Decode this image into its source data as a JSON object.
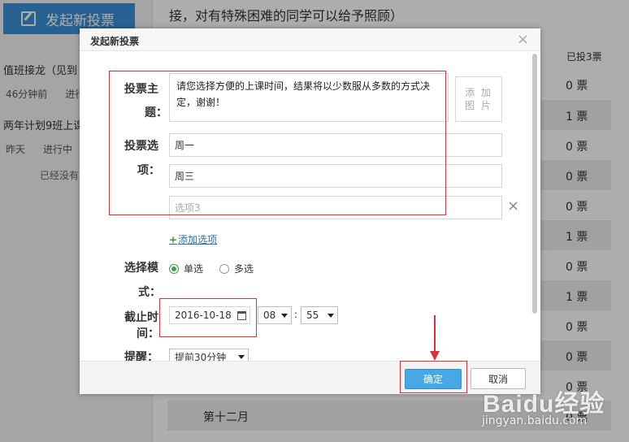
{
  "background": {
    "launch_button": "发起新投票",
    "notice_line": "接，对有特殊困难的同学可以给予照顾）",
    "entries": [
      {
        "title": "值班接龙（见到",
        "time": "46分钟前",
        "status": "进行"
      },
      {
        "title": "两年计划9班上课",
        "time": "昨天",
        "status": "进行中"
      }
    ],
    "no_more": "已经没有了",
    "voted_header": "已投3票",
    "result_values": [
      "0 票",
      "1 票",
      "0 票",
      "0 票",
      "0 票",
      "1 票",
      "0 票",
      "1 票",
      "0 票",
      "0 票",
      "0 票",
      "0 票"
    ],
    "month_label": "第十二月"
  },
  "dialog": {
    "title": "发起新投票",
    "close_symbol": "×",
    "subject_label_1": "投票主",
    "subject_label_2": "题：",
    "subject_text": "请您选择方便的上课时间，结果将以少数服从多数的方式决定，谢谢！",
    "add_image_line1": "添 加",
    "add_image_line2": "图 片",
    "options_label_1": "投票选",
    "options_label_2": "项：",
    "option_values": [
      "周一",
      "周三"
    ],
    "option_placeholder": "选项3",
    "delete_symbol": "×",
    "add_option_plus": "+",
    "add_option_label": "添加选项",
    "mode_label_1": "选择模",
    "mode_label_2": "式：",
    "mode_single": "单选",
    "mode_multi": "多选",
    "mode_selected": "single",
    "deadline_label_1": "截止时",
    "deadline_label_2": "间：",
    "deadline_date": "2016-10-18",
    "deadline_hour": "08",
    "deadline_minute": "55",
    "time_separator": ":",
    "remind_label": "提醒：",
    "remind_value": "提前30分钟",
    "ok_label": "确定",
    "cancel_label": "取消"
  },
  "watermark": {
    "logo": "Baidu经验",
    "url": "jingyan.baidu.com"
  },
  "colors": {
    "accent": "#47a8e6",
    "annotation": "#d9333a",
    "radio_selected": "#3e9e4a"
  }
}
